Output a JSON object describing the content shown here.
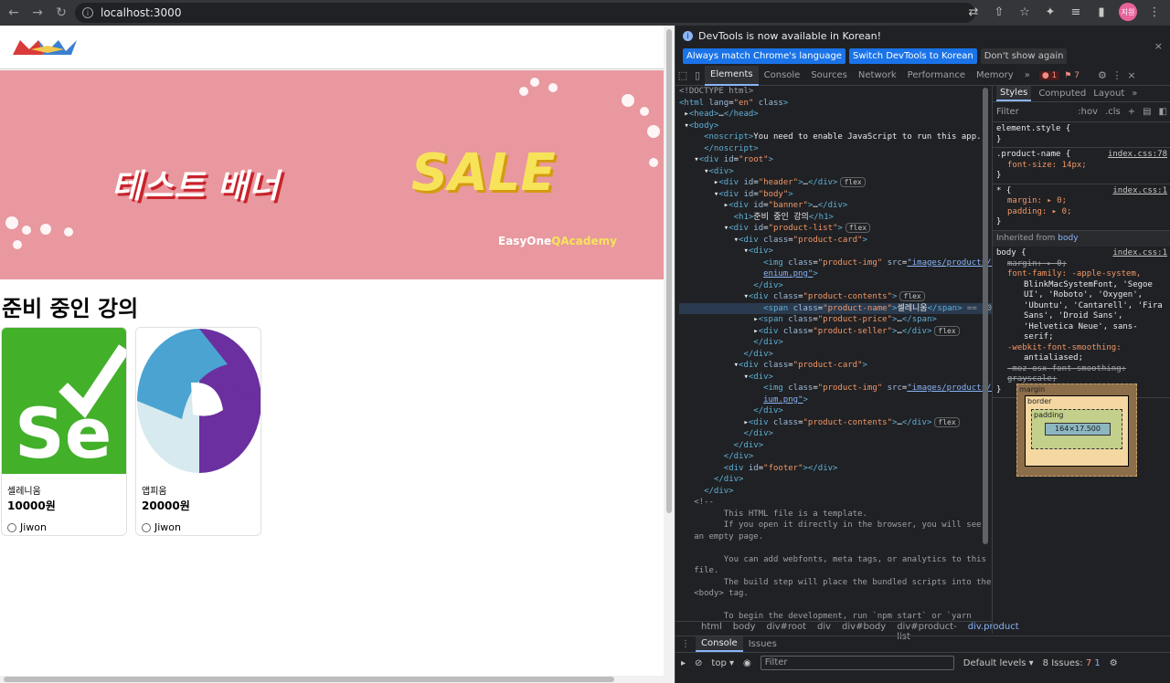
{
  "browser": {
    "url": "localhost:3000",
    "avatar_text": "지원"
  },
  "page": {
    "banner": {
      "title": "테스트 배너",
      "sale": "SALE",
      "sub_prefix": "EasyOne",
      "sub_suffix": "QAcademy"
    },
    "section_title": "준비 중인 강의",
    "products": [
      {
        "name": "셀레니움",
        "price": "10000원",
        "seller": "Jiwon",
        "logo_text": "Se"
      },
      {
        "name": "앱피움",
        "price": "20000원",
        "seller": "Jiwon"
      }
    ]
  },
  "devtools": {
    "notice": "DevTools is now available in Korean!",
    "btn_match": "Always match Chrome's language",
    "btn_switch": "Switch DevTools to Korean",
    "btn_dont": "Don't show again",
    "tabs": [
      "Elements",
      "Console",
      "Sources",
      "Network",
      "Performance",
      "Memory"
    ],
    "more_tabs": "»",
    "error_count": "1",
    "warning_count": "7",
    "breadcrumbs": [
      "html",
      "body",
      "div#root",
      "div",
      "div#body",
      "div#product-list",
      "div.product"
    ],
    "styles_tabs": [
      "Styles",
      "Computed",
      "Layout"
    ],
    "filter_placeholder": "Filter",
    "hov": ":hov",
    "cls": ".cls",
    "element_style": "element.style {",
    "rule1_selector": ".product-name {",
    "rule1_src": "index.css:78",
    "rule1_prop": "font-size: 14px;",
    "rule2_selector": "* {",
    "rule2_src": "index.css:1",
    "rule2_prop1": "margin: ▸ 0;",
    "rule2_prop2": "padding: ▸ 0;",
    "inherited_label": "Inherited from",
    "inherited_from": "body",
    "rule3_selector": "body {",
    "rule3_src": "index.css:1",
    "rule3_prop1": "margin: ▸ 0;",
    "rule3_prop2": "font-family: -apple-system,",
    "rule3_font_cont": "BlinkMacSystemFont, 'Segoe UI', 'Roboto', 'Oxygen', 'Ubuntu', 'Cantarell', 'Fira Sans', 'Droid Sans', 'Helvetica Neue', sans-serif;",
    "rule3_prop3": "-webkit-font-smoothing:",
    "rule3_prop3_val": "antialiased;",
    "rule3_prop4": "-moz-osx-font-smoothing: grayscale;",
    "box_margin": "margin",
    "box_border": "border",
    "box_padding": "padding",
    "box_content": "164×17.500",
    "box_dash": "-",
    "console_tabs": [
      "Console",
      "Issues"
    ],
    "console_context": "top ▾",
    "console_filter": "Filter",
    "default_levels": "Default levels ▾",
    "issues_label": "8 Issues:",
    "issues_err": "7",
    "issues_info": "1"
  }
}
